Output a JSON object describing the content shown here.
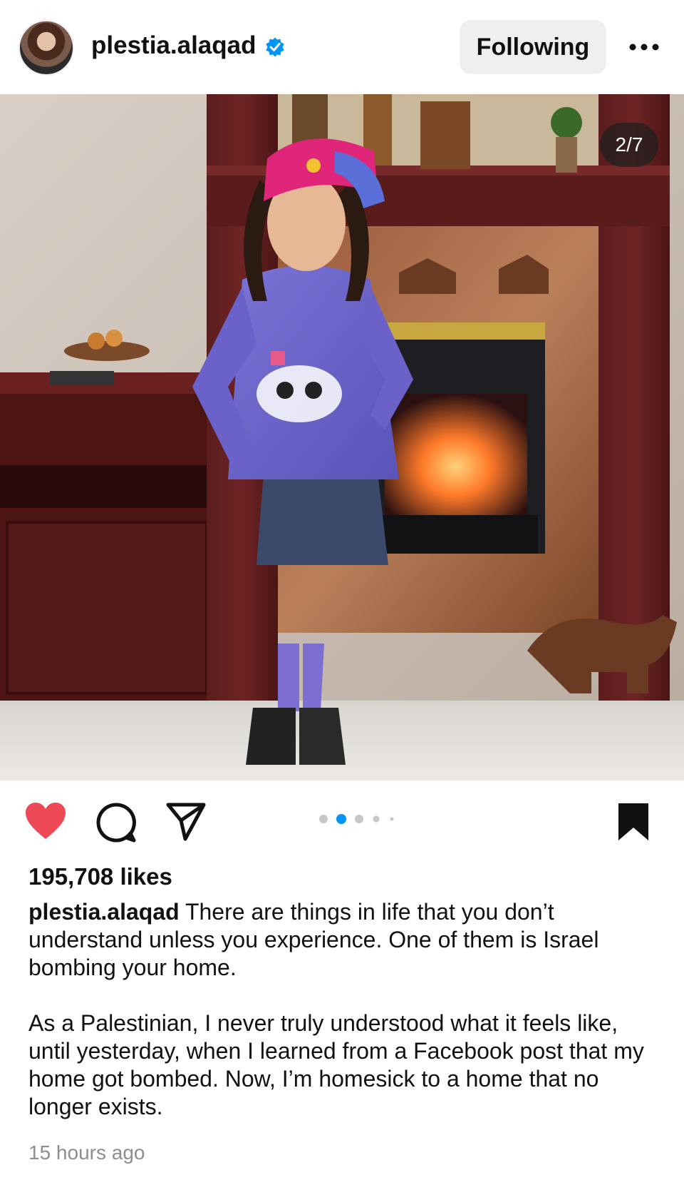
{
  "header": {
    "username": "plestia.alaqad",
    "follow_label": "Following",
    "more_icon": "more-horizontal-icon",
    "verified_icon": "verified-badge-icon",
    "verified_color": "#0095f6"
  },
  "post": {
    "counter": "2/7",
    "carousel": {
      "total_dots_visible": 5,
      "active_index": 1
    },
    "colors": {
      "like": "#ed4956",
      "dot_active": "#0095f6",
      "dot_inactive": "#c7c7c7"
    }
  },
  "actions": {
    "like_icon": "heart-filled-icon",
    "comment_icon": "comment-icon",
    "share_icon": "send-icon",
    "save_icon": "bookmark-filled-icon"
  },
  "likes_text": "195,708 likes",
  "caption": {
    "username": "plestia.alaqad",
    "paragraph1": "There are things in life that you don’t understand unless you experience. One of them is Israel bombing your home.",
    "paragraph2": "As a Palestinian, I never truly understood what it feels like, until yesterday, when I learned from a Facebook post that my home got bombed. Now, I’m homesick to a home that no longer exists."
  },
  "timestamp": "15 hours ago"
}
